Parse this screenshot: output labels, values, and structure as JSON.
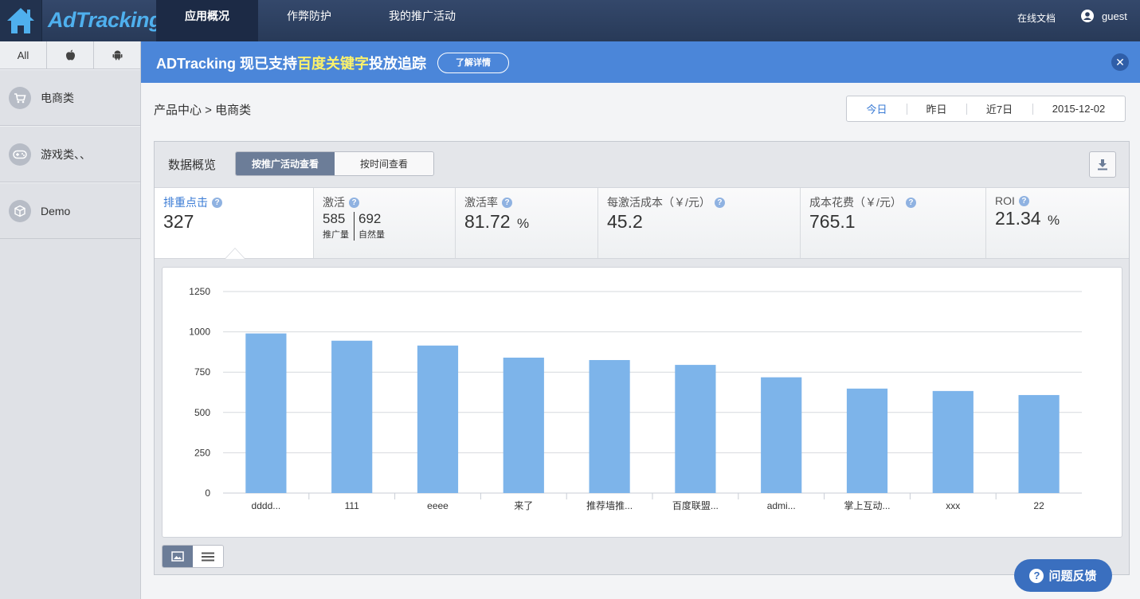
{
  "brand": {
    "logo_text": "AdTracking"
  },
  "nav": {
    "items": [
      {
        "label": "应用概况",
        "active": true
      },
      {
        "label": "作弊防护",
        "active": false
      },
      {
        "label": "我的推广活动",
        "active": false
      }
    ],
    "doc_link": "在线文档",
    "user": "guest"
  },
  "sidebar": {
    "platform_tabs": [
      {
        "label": "All",
        "icon": ""
      },
      {
        "label": "",
        "icon": "apple-icon"
      },
      {
        "label": "",
        "icon": "android-icon"
      }
    ],
    "items": [
      {
        "label": "电商类",
        "icon": "cart-icon"
      },
      {
        "label": "游戏类、、",
        "icon": "gamepad-icon"
      },
      {
        "label": "Demo",
        "icon": "box-icon"
      }
    ]
  },
  "banner": {
    "text_prefix": "ADTracking 现已支持",
    "text_highlight": "百度关键字",
    "text_suffix": "投放追踪",
    "button_label": "了解详情",
    "close_label": "✕"
  },
  "breadcrumb": {
    "text": "产品中心 > 电商类"
  },
  "date_range": {
    "options": [
      "今日",
      "昨日",
      "近7日",
      "2015-12-02"
    ],
    "active_index": 0
  },
  "panel": {
    "title": "数据概览",
    "view_buttons": [
      "按推广活动查看",
      "按时间查看"
    ],
    "active_view": 0
  },
  "metrics": [
    {
      "label": "排重点击",
      "value": "327",
      "unit": ""
    },
    {
      "label": "激活",
      "parts": [
        {
          "value": "585",
          "sub": "推广量"
        },
        {
          "value": "692",
          "sub": "自然量"
        }
      ]
    },
    {
      "label": "激活率",
      "value": "81.72",
      "unit": "%"
    },
    {
      "label": "每激活成本（￥/元）",
      "value": "45.2",
      "unit": ""
    },
    {
      "label": "成本花费（￥/元）",
      "value": "765.1",
      "unit": ""
    },
    {
      "label": "ROI",
      "value": "21.34",
      "unit": "%"
    }
  ],
  "chart_data": {
    "type": "bar",
    "categories": [
      "dddd...",
      "111",
      "eeee",
      "来了",
      "推荐墙推...",
      "百度联盟...",
      "admi...",
      "掌上互动...",
      "xxx",
      "22"
    ],
    "values": [
      990,
      945,
      915,
      840,
      825,
      795,
      718,
      648,
      633,
      608
    ],
    "ylim": [
      0,
      1250
    ],
    "yticks": [
      0,
      250,
      500,
      750,
      1000,
      1250
    ],
    "color": "#7db4ea",
    "grid": true
  },
  "feedback": {
    "label": "问题反馈"
  },
  "colors": {
    "topbar": "#2d3f5f",
    "banner": "#4b86d9",
    "accent": "#3a7bd5",
    "bar": "#7db4ea"
  }
}
